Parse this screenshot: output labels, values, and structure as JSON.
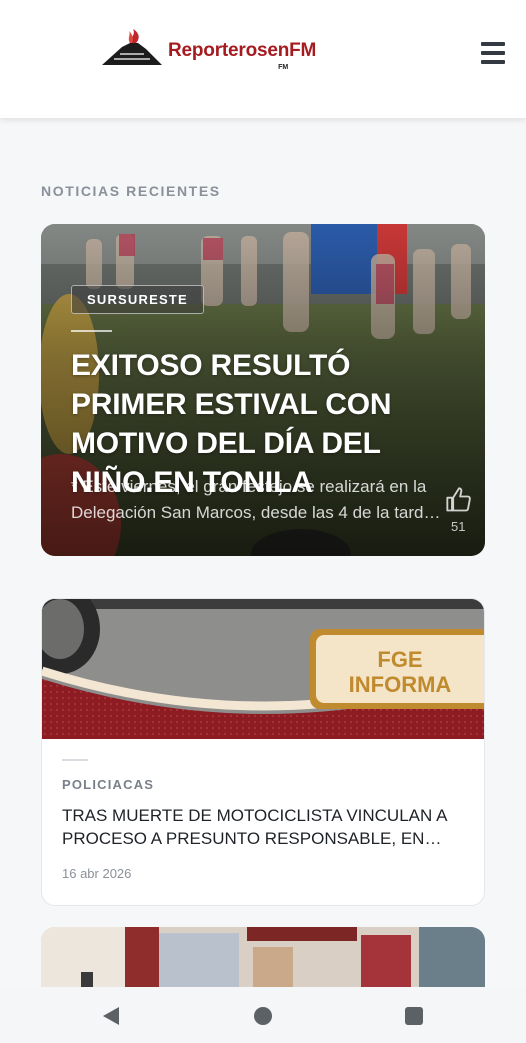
{
  "header": {
    "logo_text": "ReporterosenFM",
    "logo_small": "FM",
    "menu_icon": "hamburger-menu-icon"
  },
  "section": {
    "title": "NOTICIAS RECIENTES"
  },
  "featured": {
    "category": "SURSURESTE",
    "title": "EXITOSO RESULTÓ PRIMER ESTIVAL CON MOTIVO DEL DÍA DEL NIÑO.EN TONILA",
    "excerpt_line1": "* Este viernes, el gran festejo se realizará en la",
    "excerpt_line2": "Delegación San Marcos, desde las 4 de la tard…",
    "like_icon": "thumbs-up-icon",
    "likes": "51"
  },
  "card": {
    "image_text_line1": "FGE",
    "image_text_line2": "INFORMA",
    "category": "POLICIACAS",
    "title": "TRAS MUERTE DE MOTOCICLISTA VINCULAN A PROCESO A PRESUNTO RESPONSABLE, EN…",
    "date": "16 abr 2026"
  },
  "system_nav": {
    "back_icon": "back-triangle-icon",
    "home_icon": "home-circle-icon",
    "recent_icon": "recent-apps-square-icon"
  },
  "colors": {
    "brand_red": "#a61b20",
    "page_bg": "#f6f7f9",
    "fge_maroon": "#8c1b22",
    "fge_gold": "#c08a2e"
  }
}
